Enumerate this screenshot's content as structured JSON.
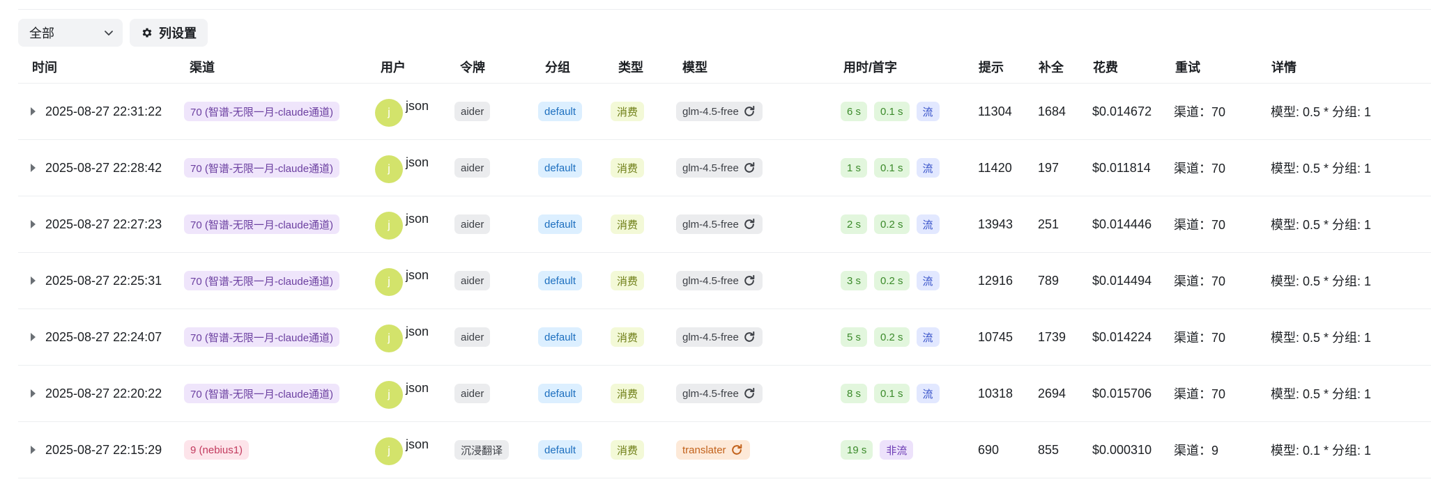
{
  "filter": {
    "selected": "全部"
  },
  "column_settings_label": "列设置",
  "columns": {
    "time": "时间",
    "channel": "渠道",
    "user": "用户",
    "token": "令牌",
    "group": "分组",
    "type": "类型",
    "model": "模型",
    "timing": "用时/首字",
    "prompt": "提示",
    "completion": "补全",
    "cost": "花费",
    "retry": "重试",
    "detail": "详情"
  },
  "rows": [
    {
      "time": "2025-08-27 22:31:22",
      "channel": "70 (智谱-无限一月-claude通道)",
      "channel_color": "purple",
      "avatar": "j",
      "user": "json",
      "token": "aider",
      "group": "default",
      "type": "消费",
      "model": "glm-4.5-free",
      "model_color": "grey",
      "duration": "6 s",
      "first_token": "0.1 s",
      "stream": "流",
      "stream_color": "indigo",
      "prompt": "11304",
      "completion": "1684",
      "cost": "$0.014672",
      "retry": "渠道：70",
      "detail": "模型: 0.5 * 分组: 1"
    },
    {
      "time": "2025-08-27 22:28:42",
      "channel": "70 (智谱-无限一月-claude通道)",
      "channel_color": "purple",
      "avatar": "j",
      "user": "json",
      "token": "aider",
      "group": "default",
      "type": "消费",
      "model": "glm-4.5-free",
      "model_color": "grey",
      "duration": "1 s",
      "first_token": "0.1 s",
      "stream": "流",
      "stream_color": "indigo",
      "prompt": "11420",
      "completion": "197",
      "cost": "$0.011814",
      "retry": "渠道：70",
      "detail": "模型: 0.5 * 分组: 1"
    },
    {
      "time": "2025-08-27 22:27:23",
      "channel": "70 (智谱-无限一月-claude通道)",
      "channel_color": "purple",
      "avatar": "j",
      "user": "json",
      "token": "aider",
      "group": "default",
      "type": "消费",
      "model": "glm-4.5-free",
      "model_color": "grey",
      "duration": "2 s",
      "first_token": "0.2 s",
      "stream": "流",
      "stream_color": "indigo",
      "prompt": "13943",
      "completion": "251",
      "cost": "$0.014446",
      "retry": "渠道：70",
      "detail": "模型: 0.5 * 分组: 1"
    },
    {
      "time": "2025-08-27 22:25:31",
      "channel": "70 (智谱-无限一月-claude通道)",
      "channel_color": "purple",
      "avatar": "j",
      "user": "json",
      "token": "aider",
      "group": "default",
      "type": "消费",
      "model": "glm-4.5-free",
      "model_color": "grey",
      "duration": "3 s",
      "first_token": "0.2 s",
      "stream": "流",
      "stream_color": "indigo",
      "prompt": "12916",
      "completion": "789",
      "cost": "$0.014494",
      "retry": "渠道：70",
      "detail": "模型: 0.5 * 分组: 1"
    },
    {
      "time": "2025-08-27 22:24:07",
      "channel": "70 (智谱-无限一月-claude通道)",
      "channel_color": "purple",
      "avatar": "j",
      "user": "json",
      "token": "aider",
      "group": "default",
      "type": "消费",
      "model": "glm-4.5-free",
      "model_color": "grey",
      "duration": "5 s",
      "first_token": "0.2 s",
      "stream": "流",
      "stream_color": "indigo",
      "prompt": "10745",
      "completion": "1739",
      "cost": "$0.014224",
      "retry": "渠道：70",
      "detail": "模型: 0.5 * 分组: 1"
    },
    {
      "time": "2025-08-27 22:20:22",
      "channel": "70 (智谱-无限一月-claude通道)",
      "channel_color": "purple",
      "avatar": "j",
      "user": "json",
      "token": "aider",
      "group": "default",
      "type": "消费",
      "model": "glm-4.5-free",
      "model_color": "grey",
      "duration": "8 s",
      "first_token": "0.1 s",
      "stream": "流",
      "stream_color": "indigo",
      "prompt": "10318",
      "completion": "2694",
      "cost": "$0.015706",
      "retry": "渠道：70",
      "detail": "模型: 0.5 * 分组: 1"
    },
    {
      "time": "2025-08-27 22:15:29",
      "channel": "9 (nebius1)",
      "channel_color": "pink",
      "avatar": "j",
      "user": "json",
      "token": "沉浸翻译",
      "group": "default",
      "type": "消费",
      "model": "translater",
      "model_color": "orange",
      "duration": "19 s",
      "first_token": null,
      "stream": "非流",
      "stream_color": "violet",
      "prompt": "690",
      "completion": "855",
      "cost": "$0.000310",
      "retry": "渠道：9",
      "detail": "模型: 0.1 * 分组: 1"
    }
  ]
}
